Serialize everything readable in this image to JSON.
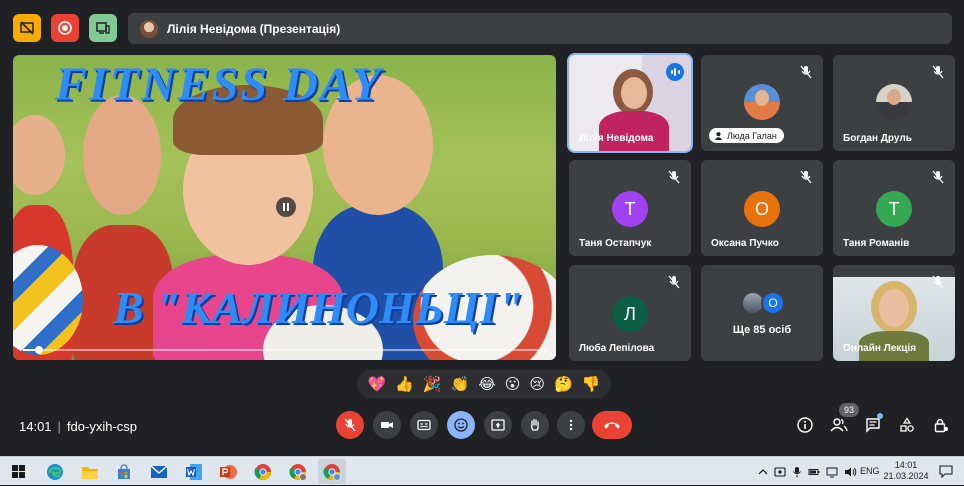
{
  "top_bar": {
    "presenter_label": "Лілія Невідома (Презентація)",
    "buttons": [
      "present-stop-icon",
      "record-icon",
      "companion-mode-icon"
    ],
    "colors": {
      "yellow": "#f9ab00",
      "red": "#ea4335",
      "green": "#81c995"
    }
  },
  "presentation": {
    "title": "FITNESS  DAY",
    "subtitle": "В \"КАЛИНОНЬЦІ\"",
    "progress": 0.03
  },
  "participants": [
    {
      "name": "Лілія Невідома",
      "type": "video",
      "speaking": true
    },
    {
      "name": "Люда Галан",
      "type": "avatar-photo",
      "muted": true,
      "pinned_label": true
    },
    {
      "name": "Богдан Друль",
      "type": "avatar-photo",
      "muted": true
    },
    {
      "name": "Таня Остапчук",
      "type": "letter",
      "letter": "Т",
      "color": "#a142f4",
      "muted": true
    },
    {
      "name": "Оксана Пучко",
      "type": "letter",
      "letter": "О",
      "color": "#e8710a",
      "muted": true
    },
    {
      "name": "Таня Романів",
      "type": "letter",
      "letter": "Т",
      "color": "#34a853",
      "muted": true
    },
    {
      "name": "Люба Лепілова",
      "type": "letter",
      "letter": "Л",
      "color": "#0d5e44",
      "muted": true
    },
    {
      "name": "Ще 85 осіб",
      "type": "more",
      "letter": "О",
      "color": "#1a73e8"
    },
    {
      "name": "Онлайн Лекція",
      "type": "video",
      "muted": true
    }
  ],
  "reactions": [
    "💖",
    "👍",
    "🎉",
    "👏",
    "😂",
    "😮",
    "😢",
    "🤔",
    "👎"
  ],
  "meeting": {
    "time": "14:01",
    "separator": "|",
    "code": "fdo-yxih-csp",
    "participant_count": "93"
  },
  "controls": [
    "mic-off-icon",
    "camera-icon",
    "captions-icon",
    "emoji-icon",
    "present-icon",
    "raise-hand-icon",
    "more-options-icon",
    "hang-up-icon"
  ],
  "right_controls": [
    "info-icon",
    "people-icon",
    "chat-icon",
    "activities-icon",
    "host-controls-icon"
  ],
  "taskbar": {
    "apps": [
      "windows-start-icon",
      "edge-icon",
      "file-explorer-icon",
      "store-icon",
      "mail-icon",
      "word-icon",
      "powerpoint-icon",
      "chrome-icon",
      "chrome-profile-icon",
      "chrome-active-icon"
    ],
    "lang": "ENG",
    "clock_time": "14:01",
    "clock_date": "21.03.2024"
  }
}
